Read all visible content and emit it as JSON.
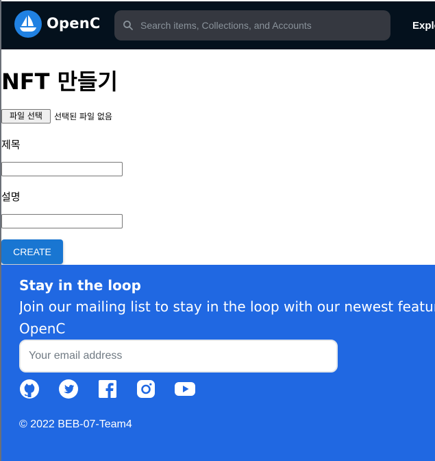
{
  "header": {
    "brand": "OpenC",
    "search_placeholder": "Search items, Collections, and Accounts",
    "nav_explore": "Explore",
    "colors": {
      "background": "#04111d",
      "logo": "#2081e2",
      "search_bg": "#353840"
    }
  },
  "main": {
    "title": "NFT 만들기",
    "file_button": "파일 선택",
    "file_status": "선택된 파일 없음",
    "title_label": "제목",
    "title_value": "",
    "description_label": "설명",
    "description_value": "",
    "create_button": "CREATE",
    "colors": {
      "create_button": "#1976d2"
    }
  },
  "footer": {
    "heading": "Stay in the loop",
    "subtext": "Join our mailing list to stay in the loop with our newest feature releases",
    "brand": "OpenC",
    "email_placeholder": "Your email address",
    "social_icons": [
      "github-icon",
      "twitter-icon",
      "facebook-icon",
      "instagram-icon",
      "youtube-icon"
    ],
    "copyright": "© 2022 BEB-07-Team4",
    "colors": {
      "background": "#2068e2"
    }
  }
}
